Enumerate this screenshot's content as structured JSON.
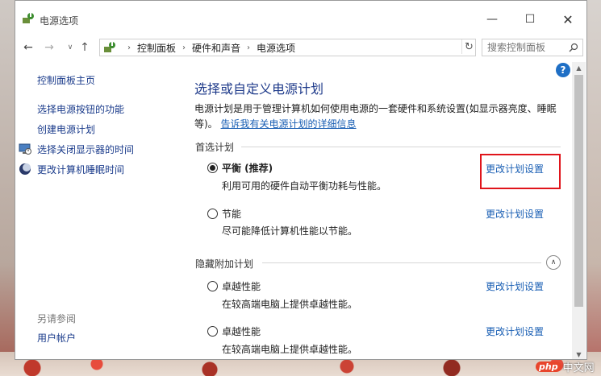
{
  "window": {
    "title": "电源选项",
    "controls": {
      "minimize": "—",
      "maximize": "☐",
      "close": "✕"
    }
  },
  "nav": {
    "back": "←",
    "forward": "→",
    "recent": "∨",
    "up": "↑",
    "breadcrumbs": [
      "控制面板",
      "硬件和声音",
      "电源选项"
    ],
    "search_placeholder": "搜索控制面板"
  },
  "sidebar": {
    "home": "控制面板主页",
    "items": [
      {
        "label": "选择电源按钮的功能",
        "icon": null
      },
      {
        "label": "创建电源计划",
        "icon": null
      },
      {
        "label": "选择关闭显示器的时间",
        "icon": "monitor-clock-icon"
      },
      {
        "label": "更改计算机睡眠时间",
        "icon": "moon-icon"
      }
    ],
    "see_also": "另请参阅",
    "user_accounts": "用户帐户"
  },
  "main": {
    "help": "?",
    "title": "选择或自定义电源计划",
    "intro": "电源计划是用于管理计算机如何使用电源的一套硬件和系统设置(如显示器亮度、睡眠等)。",
    "intro_link": "告诉我有关电源计划的详细信息",
    "preferred_label": "首选计划",
    "hidden_label": "隐藏附加计划",
    "plans": [
      {
        "name": "平衡 (推荐)",
        "desc": "利用可用的硬件自动平衡功耗与性能。",
        "link": "更改计划设置",
        "selected": true
      },
      {
        "name": "节能",
        "desc": "尽可能降低计算机性能以节能。",
        "link": "更改计划设置",
        "selected": false
      },
      {
        "name": "卓越性能",
        "desc": "在较高端电脑上提供卓越性能。",
        "link": "更改计划设置",
        "selected": false
      },
      {
        "name": "卓越性能",
        "desc": "在较高端电脑上提供卓越性能。",
        "link": "更改计划设置",
        "selected": false
      }
    ]
  },
  "watermark": {
    "logo": "php",
    "text": "中文网"
  },
  "colors": {
    "link": "#1a5fb4",
    "title": "#1e3a8a",
    "highlight": "#e0151b"
  }
}
